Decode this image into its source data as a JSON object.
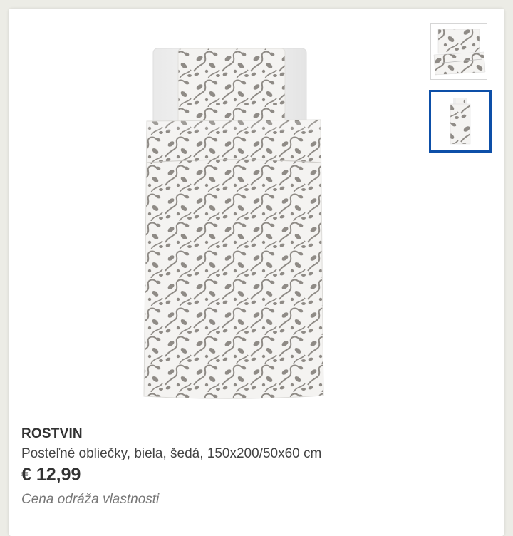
{
  "product": {
    "name": "ROSTVIN",
    "description": "Posteľné obliečky, biela, šedá, 150x200/50x60 cm",
    "price": "€ 12,99",
    "price_note": "Cena odráža vlastnosti"
  },
  "gallery": {
    "selected_index": 1,
    "thumbnails": [
      "bed-set-folded-thumbnail",
      "bed-set-spread-thumbnail"
    ]
  },
  "colors": {
    "pattern": "#8f8b86",
    "fabric": "#f4f3f1",
    "selected_border": "#0d4fa8"
  }
}
